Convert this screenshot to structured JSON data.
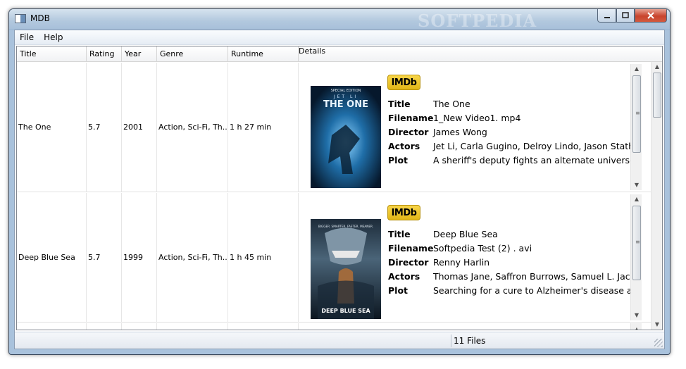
{
  "window": {
    "title": "MDB",
    "watermark": "SOFTPEDIA"
  },
  "menu": {
    "items": [
      "File",
      "Help"
    ]
  },
  "table": {
    "columns": [
      "Title",
      "Rating",
      "Year",
      "Genre",
      "Runtime",
      "Details"
    ],
    "rows": [
      {
        "title": "The One",
        "rating": "5.7",
        "year": "2001",
        "genre": "Action, Sci-Fi, Th...",
        "runtime": "1 h 27 min",
        "details": {
          "logo": "IMDb",
          "poster_icon": "poster-the-one",
          "fields": [
            {
              "key": "Title",
              "value": "The One"
            },
            {
              "key": "Filename",
              "value": "1_New Video1. mp4"
            },
            {
              "key": "Director",
              "value": "James Wong"
            },
            {
              "key": "Actors",
              "value": "Jet Li, Carla Gugino, Delroy Lindo, Jason Statham"
            },
            {
              "key": "Plot",
              "value": "A sheriff's deputy fights an alternate universe version of himself who grows stronger with"
            }
          ],
          "poster_text": [
            "SPECIAL EDITION",
            "JET LI",
            "THE ONE"
          ]
        }
      },
      {
        "title": "Deep Blue Sea",
        "rating": "5.7",
        "year": "1999",
        "genre": "Action, Sci-Fi, Th...",
        "runtime": "1 h 45 min",
        "details": {
          "logo": "IMDb",
          "poster_icon": "poster-deep-blue-sea",
          "fields": [
            {
              "key": "Title",
              "value": "Deep Blue Sea"
            },
            {
              "key": "Filename",
              "value": "Softpedia Test (2) . avi"
            },
            {
              "key": "Director",
              "value": "Renny Harlin"
            },
            {
              "key": "Actors",
              "value": "Thomas Jane, Saffron Burrows, Samuel L. Jackson, Jacqueline McKenzie"
            },
            {
              "key": "Plot",
              "value": "Searching for a cure to Alzheimer's disease a group of scientists on an isolated research"
            }
          ],
          "poster_text": [
            "BIGGER. SMARTER. FASTER. MEANER.",
            "DEEP BLUE SEA"
          ]
        }
      }
    ]
  },
  "status": {
    "files": "11 Files"
  },
  "colors": {
    "imdb_yellow": "#f5c518",
    "titlebar": "#b2c8de"
  }
}
